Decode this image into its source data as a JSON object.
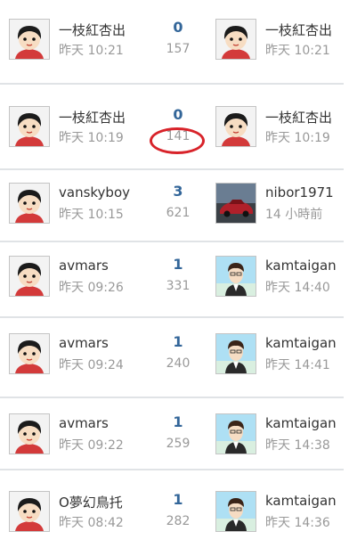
{
  "rows": [
    {
      "starter": {
        "name": "一枝紅杏出",
        "time": "昨天 10:21",
        "avatar": "cartoon-girl-avatar"
      },
      "replies": "0",
      "views": "157",
      "last": {
        "name": "一枝紅杏出",
        "time": "昨天 10:21",
        "avatar": "cartoon-girl-avatar"
      }
    },
    {
      "starter": {
        "name": "一枝紅杏出",
        "time": "昨天 10:19",
        "avatar": "cartoon-girl-avatar"
      },
      "replies": "0",
      "views": "141",
      "last": {
        "name": "一枝紅杏出",
        "time": "昨天 10:19",
        "avatar": "cartoon-girl-avatar"
      }
    },
    {
      "starter": {
        "name": "vanskyboy",
        "time": "昨天 10:15",
        "avatar": "cartoon-girl-avatar"
      },
      "replies": "3",
      "views": "621",
      "last": {
        "name": "nibor1971",
        "time": "14 小時前",
        "avatar": "red-car-avatar"
      }
    },
    {
      "starter": {
        "name": "avmars",
        "time": "昨天 09:26",
        "avatar": "cartoon-girl-avatar"
      },
      "replies": "1",
      "views": "331",
      "last": {
        "name": "kamtaigan",
        "time": "昨天 14:40",
        "avatar": "anime-man-avatar"
      }
    },
    {
      "starter": {
        "name": "avmars",
        "time": "昨天 09:24",
        "avatar": "cartoon-girl-avatar"
      },
      "replies": "1",
      "views": "240",
      "last": {
        "name": "kamtaigan",
        "time": "昨天 14:41",
        "avatar": "anime-man-avatar"
      }
    },
    {
      "starter": {
        "name": "avmars",
        "time": "昨天 09:22",
        "avatar": "cartoon-girl-avatar"
      },
      "replies": "1",
      "views": "259",
      "last": {
        "name": "kamtaigan",
        "time": "昨天 14:38",
        "avatar": "anime-man-avatar"
      }
    },
    {
      "starter": {
        "name": "O夢幻鳥托",
        "time": "昨天 08:42",
        "avatar": "cartoon-girl-avatar"
      },
      "replies": "1",
      "views": "282",
      "last": {
        "name": "kamtaigan",
        "time": "昨天 14:36",
        "avatar": "anime-man-avatar"
      }
    }
  ],
  "annotation": {
    "color": "#d8232a",
    "highlighted_value": "141"
  }
}
